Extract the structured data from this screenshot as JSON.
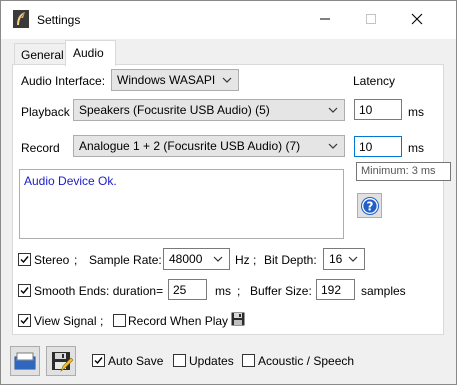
{
  "window": {
    "title": "Settings"
  },
  "tabs": [
    {
      "label": "General"
    },
    {
      "label": "Audio"
    }
  ],
  "audio": {
    "interface_label": "Audio Interface:",
    "interface_value": "Windows WASAPI",
    "latency_header": "Latency",
    "playback_label": "Playback",
    "playback_value": "Speakers (Focusrite USB Audio) (5)",
    "playback_latency": "10",
    "record_label": "Record",
    "record_value": "Analogue 1 + 2 (Focusrite USB Audio) (7)",
    "record_latency": "10",
    "ms_unit": "ms",
    "tooltip": "Minimum: 3 ms",
    "status": "Audio Device Ok."
  },
  "options": {
    "stereo_label": "Stereo",
    "stereo_checked": true,
    "sep": ";",
    "sample_rate_label": "Sample Rate:",
    "sample_rate_value": "48000",
    "hz_sep": "Hz ;",
    "bit_depth_label": "Bit Depth:",
    "bit_depth_value": "16",
    "smooth_label": "Smooth Ends: duration=",
    "smooth_checked": true,
    "smooth_value": "25",
    "smooth_unit": "ms",
    "buffer_label": "Buffer Size:",
    "buffer_value": "192",
    "buffer_unit": "samples",
    "view_signal_label": "View Signal",
    "view_signal_checked": true,
    "record_when_play_label": "Record When Play",
    "record_when_play_checked": false
  },
  "bottom": {
    "auto_save_label": "Auto Save",
    "auto_save_checked": true,
    "updates_label": "Updates",
    "updates_checked": false,
    "acoustic_label": "Acoustic / Speech",
    "acoustic_checked": false
  },
  "colors": {
    "status_text": "#1c1ccc",
    "help_icon": "#1f5fc7",
    "accent": "#0078d7"
  }
}
